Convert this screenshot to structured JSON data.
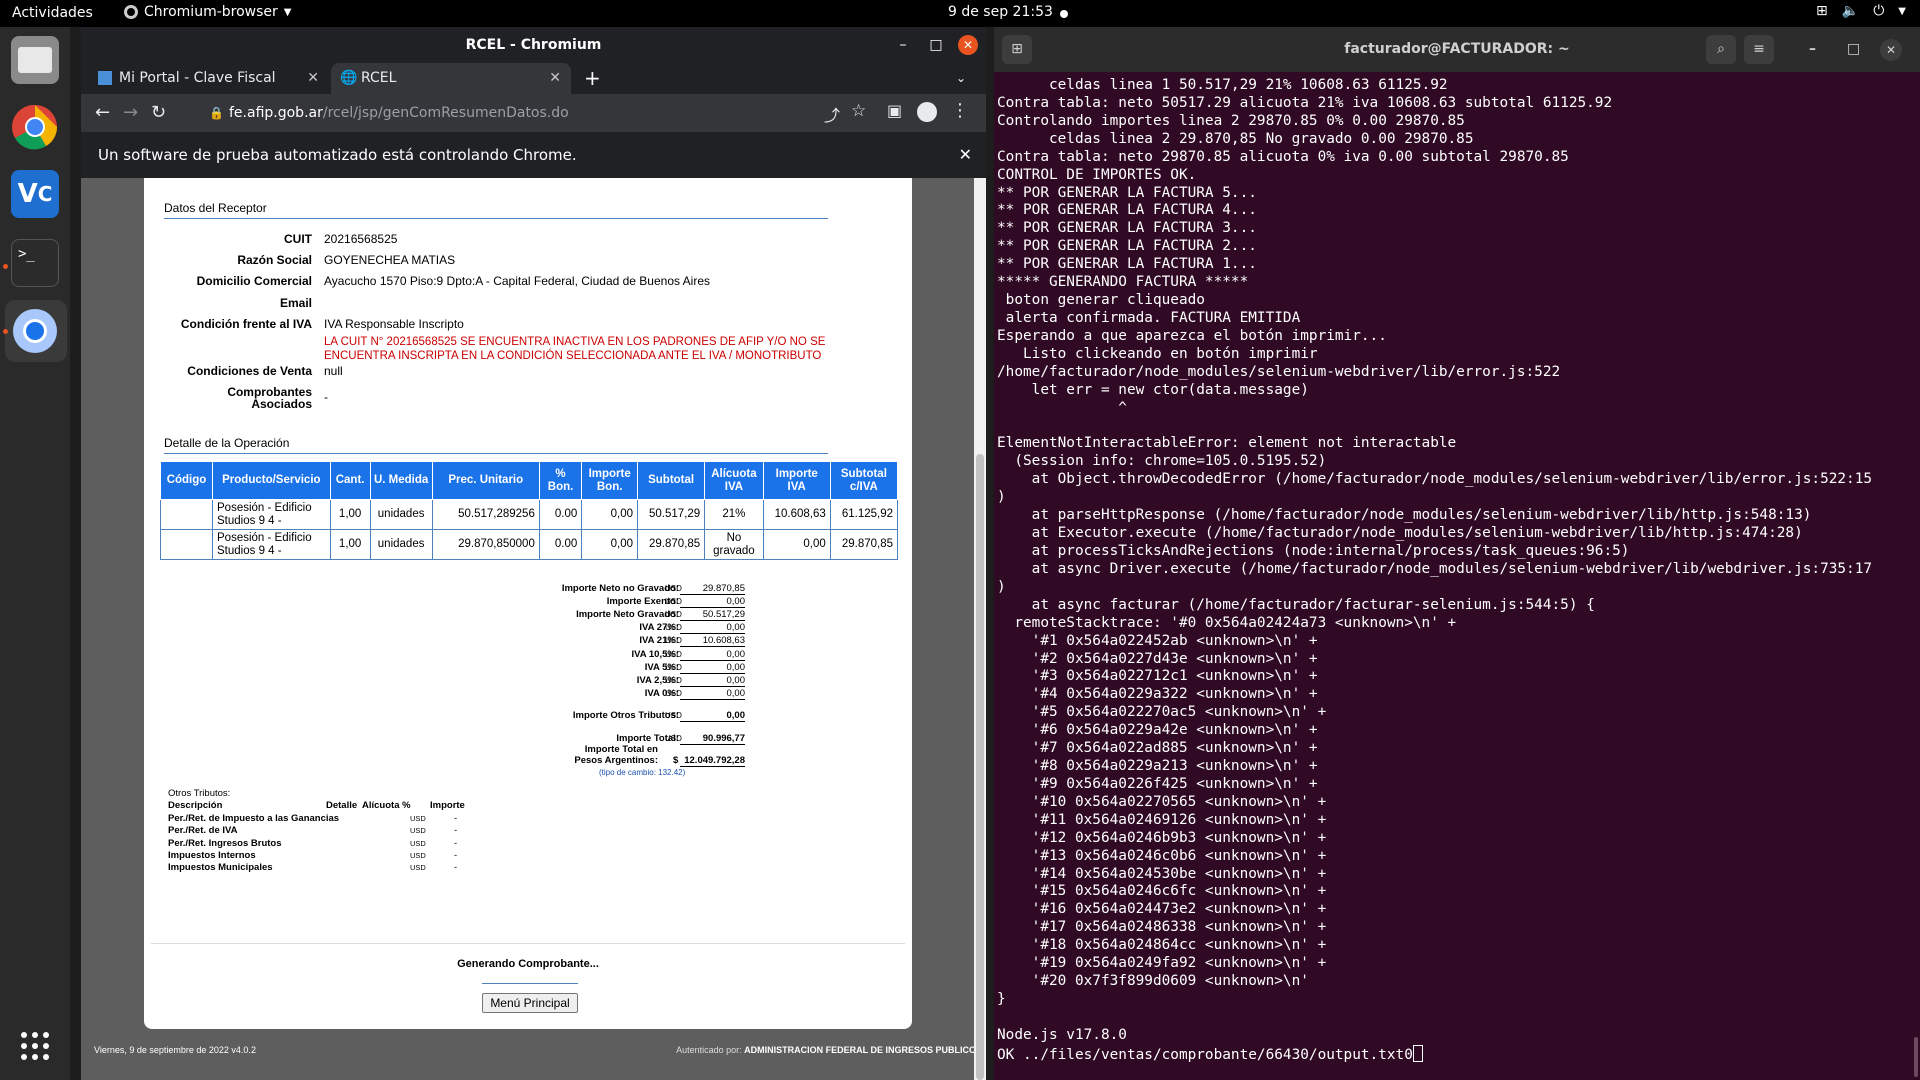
{
  "topbar": {
    "activities": "Actividades",
    "app_name": "Chromium-browser",
    "clock": "9 de sep  21:53"
  },
  "browser": {
    "window_title": "RCEL - Chromium",
    "tabs": [
      {
        "label": "Mi Portal - Clave Fiscal"
      },
      {
        "label": "RCEL"
      }
    ],
    "url_domain": "fe.afip.gob.ar",
    "url_path": "/rcel/jsp/genComResumenDatos.do",
    "infobar_text": "Un software de prueba automatizado está controlando Chrome."
  },
  "receptor": {
    "section_title": "Datos del Receptor",
    "cuit_label": "CUIT",
    "cuit_value": "20216568525",
    "razon_label": "Razón Social",
    "razon_value": "GOYENECHEA MATIAS",
    "domicilio_label": "Domicilio Comercial",
    "domicilio_value": "Ayacucho 1570 Piso:9 Dpto:A - Capital Federal, Ciudad de Buenos Aires",
    "email_label": "Email",
    "iva_label": "Condición frente al IVA",
    "iva_value": "IVA Responsable Inscripto",
    "warning": "LA CUIT N° 20216568525 SE ENCUENTRA INACTIVA EN LOS PADRONES DE AFIP Y/O NO SE ENCUENTRA INSCRIPTA EN LA CONDICIÓN SELECCIONADA ANTE EL IVA / MONOTRIBUTO",
    "venta_label": "Condiciones de Venta",
    "venta_value": "null",
    "comp_label_1": "Comprobantes",
    "comp_label_2": "Asociados",
    "comp_value": "-"
  },
  "detalle": {
    "section_title": "Detalle de la Operación",
    "headers": [
      "Código",
      "Producto/Servicio",
      "Cant.",
      "U. Medida",
      "Prec. Unitario",
      "% Bon.",
      "Importe Bon.",
      "Subtotal",
      "Alícuota IVA",
      "Importe IVA",
      "Subtotal c/IVA"
    ],
    "rows": [
      [
        "",
        "Posesión - Edificio Studios 9 4 -",
        "1,00",
        "unidades",
        "50.517,289256",
        "0.00",
        "0,00",
        "50.517,29",
        "21%",
        "10.608,63",
        "61.125,92"
      ],
      [
        "",
        "Posesión - Edificio Studios 9 4 -",
        "1,00",
        "unidades",
        "29.870,850000",
        "0.00",
        "0,00",
        "29.870,85",
        "No gravado",
        "0,00",
        "29.870,85"
      ]
    ]
  },
  "totales": {
    "currency": "USD",
    "items": [
      {
        "label": "Importe Neto no Gravado:",
        "value": "29.870,85"
      },
      {
        "label": "Importe Exento:",
        "value": "0,00"
      },
      {
        "label": "Importe Neto Gravado:",
        "value": "50.517,29"
      },
      {
        "label": "IVA 27%:",
        "value": "0,00"
      },
      {
        "label": "IVA 21%:",
        "value": "10.608,63"
      },
      {
        "label": "IVA 10,5%:",
        "value": "0,00"
      },
      {
        "label": "IVA 5%:",
        "value": "0,00"
      },
      {
        "label": "IVA 2,5%:",
        "value": "0,00"
      },
      {
        "label": "IVA 0%:",
        "value": "0,00"
      }
    ],
    "otros_label": "Importe Otros Tributos:",
    "otros_value": "0,00",
    "total_label": "Importe Total:",
    "total_value": "90.996,77",
    "ars_label_1": "Importe Total en",
    "ars_label_2": "Pesos Argentinos:",
    "ars_symbol": "$",
    "ars_value": "12.049.792,28",
    "tipo_cambio": "(tipo de cambio: 132.42)"
  },
  "otros_tributos": {
    "title": "Otros Tributos:",
    "headers": [
      "Descripción",
      "Detalle",
      "Alícuota %",
      "Importe"
    ],
    "rows": [
      {
        "desc": "Per./Ret. de Impuesto a las Ganancias",
        "cur": "USD",
        "imp": "-"
      },
      {
        "desc": "Per./Ret. de IVA",
        "cur": "USD",
        "imp": "-"
      },
      {
        "desc": "Per./Ret. Ingresos Brutos",
        "cur": "USD",
        "imp": "-"
      },
      {
        "desc": "Impuestos Internos",
        "cur": "USD",
        "imp": "-"
      },
      {
        "desc": "Impuestos Municipales",
        "cur": "USD",
        "imp": "-"
      }
    ]
  },
  "actions": {
    "generating": "Generando Comprobante...",
    "menu_button": "Menú Principal"
  },
  "footer": {
    "date": "Viernes, 9 de septiembre de 2022 v4.0.2",
    "auth_label": "Autenticado por:",
    "auth_value": "ADMINISTRACION FEDERAL DE INGRESOS PUBLICOS"
  },
  "terminal": {
    "title": "facturador@FACTURADOR: ~",
    "lines": [
      "      celdas linea 1 50.517,29 21% 10608.63 61125.92",
      "Contra tabla: neto 50517.29 alicuota 21% iva 10608.63 subtotal 61125.92",
      "Controlando importes linea 2 29870.85 0% 0.00 29870.85",
      "      celdas linea 2 29.870,85 No gravado 0.00 29870.85",
      "Contra tabla: neto 29870.85 alicuota 0% iva 0.00 subtotal 29870.85",
      "CONTROL DE IMPORTES OK.",
      "** POR GENERAR LA FACTURA 5...",
      "** POR GENERAR LA FACTURA 4...",
      "** POR GENERAR LA FACTURA 3...",
      "** POR GENERAR LA FACTURA 2...",
      "** POR GENERAR LA FACTURA 1...",
      "***** GENERANDO FACTURA *****",
      " boton generar cliqueado",
      " alerta confirmada. FACTURA EMITIDA",
      "Esperando a que aparezca el botón imprimir...",
      "   Listo clickeando en botón imprimir",
      "/home/facturador/node_modules/selenium-webdriver/lib/error.js:522",
      "    let err = new ctor(data.message)",
      "              ^",
      "",
      "ElementNotInteractableError: element not interactable",
      "  (Session info: chrome=105.0.5195.52)",
      "    at Object.throwDecodedError (/home/facturador/node_modules/selenium-webdriver/lib/error.js:522:15",
      ")",
      "    at parseHttpResponse (/home/facturador/node_modules/selenium-webdriver/lib/http.js:548:13)",
      "    at Executor.execute (/home/facturador/node_modules/selenium-webdriver/lib/http.js:474:28)",
      "    at processTicksAndRejections (node:internal/process/task_queues:96:5)",
      "    at async Driver.execute (/home/facturador/node_modules/selenium-webdriver/lib/webdriver.js:735:17",
      ")",
      "    at async facturar (/home/facturador/facturar-selenium.js:544:5) {",
      "  remoteStacktrace: '#0 0x564a02424a73 <unknown>\\n' +",
      "    '#1 0x564a022452ab <unknown>\\n' +",
      "    '#2 0x564a0227d43e <unknown>\\n' +",
      "    '#3 0x564a022712c1 <unknown>\\n' +",
      "    '#4 0x564a0229a322 <unknown>\\n' +",
      "    '#5 0x564a022270ac5 <unknown>\\n' +",
      "    '#6 0x564a0229a42e <unknown>\\n' +",
      "    '#7 0x564a022ad885 <unknown>\\n' +",
      "    '#8 0x564a0229a213 <unknown>\\n' +",
      "    '#9 0x564a0226f425 <unknown>\\n' +",
      "    '#10 0x564a02270565 <unknown>\\n' +",
      "    '#11 0x564a02469126 <unknown>\\n' +",
      "    '#12 0x564a0246b9b3 <unknown>\\n' +",
      "    '#13 0x564a0246c0b6 <unknown>\\n' +",
      "    '#14 0x564a024530be <unknown>\\n' +",
      "    '#15 0x564a0246c6fc <unknown>\\n' +",
      "    '#16 0x564a024473e2 <unknown>\\n' +",
      "    '#17 0x564a02486338 <unknown>\\n' +",
      "    '#18 0x564a024864cc <unknown>\\n' +",
      "    '#19 0x564a0249fa92 <unknown>\\n' +",
      "    '#20 0x7f3f899d0609 <unknown>\\n'",
      "}",
      "",
      "Node.js v17.8.0"
    ],
    "prompt_line": "OK ../files/ventas/comprobante/66430/output.txt0"
  }
}
